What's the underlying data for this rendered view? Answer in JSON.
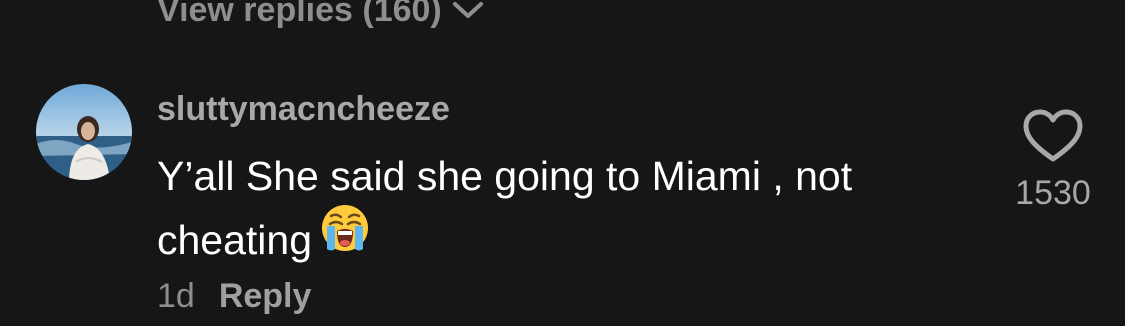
{
  "thread": {
    "view_replies_label": "View replies (160)",
    "expand_icon": "chevron-down-icon"
  },
  "comment": {
    "username": "sluttymacncheeze",
    "text_line1": "Y’all She said she going to Miami , not",
    "text_line2": "cheating",
    "emoji": "loudly-crying-face",
    "timestamp": "1d",
    "reply_label": "Reply",
    "like_count": "1530",
    "like_icon": "heart-outline-icon"
  },
  "colors": {
    "background": "#161616",
    "primary_text": "#ffffff",
    "secondary_text": "#8e8e8e",
    "username_text": "#a8a8a8"
  }
}
